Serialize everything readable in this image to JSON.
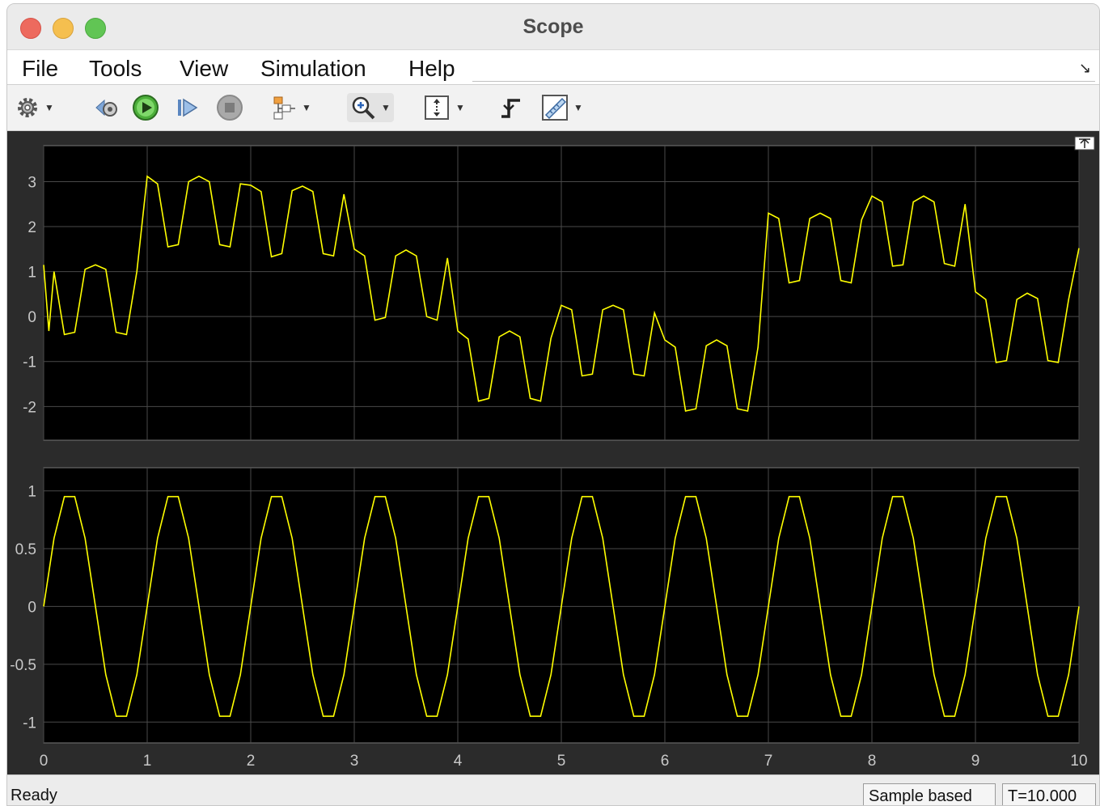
{
  "window": {
    "title": "Scope"
  },
  "menu": {
    "items": [
      "File",
      "Tools",
      "View",
      "Simulation",
      "Help"
    ]
  },
  "toolbar": {
    "icons": [
      "gear-icon",
      "step-back-icon",
      "run-icon",
      "step-forward-icon",
      "stop-icon",
      "highlight-block-icon",
      "zoom-in-icon",
      "scale-axes-icon",
      "triggers-icon",
      "measurements-icon"
    ]
  },
  "status": {
    "text": "Ready",
    "sample_mode": "Sample based",
    "time": "T=10.000"
  },
  "colors": {
    "trace": "#ffff00",
    "axes_bg": "#000000",
    "grid": "#4a4a4a",
    "tick_text": "#c8c8c8",
    "frame_bg": "#2b2b2b"
  },
  "chart_data": [
    {
      "type": "line",
      "xlim": [
        0,
        10
      ],
      "ylim": [
        -2.75,
        3.8
      ],
      "yticks": [
        3,
        2,
        1,
        0,
        -1,
        -2
      ],
      "yticklabels": [
        "3",
        "2",
        "1",
        "0",
        "-1",
        "-2"
      ],
      "xticks": [
        0,
        1,
        2,
        3,
        4,
        5,
        6,
        7,
        8,
        9,
        10
      ],
      "grid": true,
      "series": [
        {
          "x": [
            0,
            0.05,
            0.1,
            0.2,
            0.3,
            0.4,
            0.5,
            0.6,
            0.7,
            0.8,
            0.9,
            1,
            1.1,
            1.2,
            1.3,
            1.4,
            1.5,
            1.6,
            1.7,
            1.8,
            1.9,
            2,
            2.1,
            2.2,
            2.3,
            2.4,
            2.5,
            2.6,
            2.7,
            2.8,
            2.9,
            3,
            3.1,
            3.2,
            3.3,
            3.4,
            3.5,
            3.6,
            3.7,
            3.8,
            3.9,
            4,
            4.1,
            4.2,
            4.3,
            4.4,
            4.5,
            4.6,
            4.7,
            4.8,
            4.9,
            5,
            5.1,
            5.2,
            5.3,
            5.4,
            5.5,
            5.6,
            5.7,
            5.8,
            5.9,
            6,
            6.1,
            6.2,
            6.3,
            6.4,
            6.5,
            6.6,
            6.7,
            6.8,
            6.9,
            7,
            7.1,
            7.2,
            7.3,
            7.4,
            7.5,
            7.6,
            7.7,
            7.8,
            7.9,
            8,
            8.1,
            8.2,
            8.3,
            8.4,
            8.5,
            8.6,
            8.7,
            8.8,
            8.9,
            9,
            9.1,
            9.2,
            9.3,
            9.4,
            9.5,
            9.6,
            9.7,
            9.8,
            9.9,
            10
          ],
          "y": [
            1.15,
            -0.32,
            1.0,
            -0.4,
            -0.35,
            1.05,
            1.15,
            1.05,
            -0.35,
            -0.4,
            1.0,
            3.12,
            2.95,
            1.55,
            1.6,
            3.0,
            3.12,
            3.0,
            1.6,
            1.55,
            2.95,
            2.92,
            2.78,
            1.33,
            1.4,
            2.8,
            2.9,
            2.78,
            1.4,
            1.35,
            2.72,
            1.5,
            1.35,
            -0.08,
            -0.02,
            1.35,
            1.48,
            1.35,
            0.0,
            -0.08,
            1.3,
            -0.32,
            -0.5,
            -1.88,
            -1.82,
            -0.45,
            -0.32,
            -0.45,
            -1.82,
            -1.88,
            -0.48,
            0.25,
            0.15,
            -1.32,
            -1.28,
            0.15,
            0.25,
            0.15,
            -1.28,
            -1.32,
            0.08,
            -0.52,
            -0.68,
            -2.1,
            -2.05,
            -0.65,
            -0.52,
            -0.65,
            -2.05,
            -2.1,
            -0.68,
            2.3,
            2.18,
            0.75,
            0.8,
            2.18,
            2.3,
            2.18,
            0.8,
            0.75,
            2.15,
            2.68,
            2.55,
            1.12,
            1.15,
            2.55,
            2.68,
            2.55,
            1.18,
            1.12,
            2.5,
            0.55,
            0.38,
            -1.02,
            -0.98,
            0.38,
            0.52,
            0.4,
            -0.98,
            -1.02,
            0.38,
            1.52
          ]
        }
      ]
    },
    {
      "type": "line",
      "xlim": [
        0,
        10
      ],
      "ylim": [
        -1.18,
        1.2
      ],
      "yticks": [
        1,
        0.5,
        0,
        -0.5,
        -1
      ],
      "yticklabels": [
        "1",
        "0.5",
        "0",
        "-0.5",
        "-1"
      ],
      "xticks": [
        0,
        1,
        2,
        3,
        4,
        5,
        6,
        7,
        8,
        9,
        10
      ],
      "xticklabels": [
        "0",
        "1",
        "2",
        "3",
        "4",
        "5",
        "6",
        "7",
        "8",
        "9",
        "10"
      ],
      "grid": true,
      "series": [
        {
          "x": [
            0,
            0.1,
            0.2,
            0.3,
            0.4,
            0.5,
            0.6,
            0.7,
            0.8,
            0.9,
            1,
            1.1,
            1.2,
            1.3,
            1.4,
            1.5,
            1.6,
            1.7,
            1.8,
            1.9,
            2,
            2.1,
            2.2,
            2.3,
            2.4,
            2.5,
            2.6,
            2.7,
            2.8,
            2.9,
            3,
            3.1,
            3.2,
            3.3,
            3.4,
            3.5,
            3.6,
            3.7,
            3.8,
            3.9,
            4,
            4.1,
            4.2,
            4.3,
            4.4,
            4.5,
            4.6,
            4.7,
            4.8,
            4.9,
            5,
            5.1,
            5.2,
            5.3,
            5.4,
            5.5,
            5.6,
            5.7,
            5.8,
            5.9,
            6,
            6.1,
            6.2,
            6.3,
            6.4,
            6.5,
            6.6,
            6.7,
            6.8,
            6.9,
            7,
            7.1,
            7.2,
            7.3,
            7.4,
            7.5,
            7.6,
            7.7,
            7.8,
            7.9,
            8,
            8.1,
            8.2,
            8.3,
            8.4,
            8.5,
            8.6,
            8.7,
            8.8,
            8.9,
            9,
            9.1,
            9.2,
            9.3,
            9.4,
            9.5,
            9.6,
            9.7,
            9.8,
            9.9,
            10
          ],
          "y": [
            0,
            0.59,
            0.95,
            0.95,
            0.59,
            0,
            -0.59,
            -0.95,
            -0.95,
            -0.59,
            0,
            0.59,
            0.95,
            0.95,
            0.59,
            0,
            -0.59,
            -0.95,
            -0.95,
            -0.59,
            0,
            0.59,
            0.95,
            0.95,
            0.59,
            0,
            -0.59,
            -0.95,
            -0.95,
            -0.59,
            0,
            0.59,
            0.95,
            0.95,
            0.59,
            0,
            -0.59,
            -0.95,
            -0.95,
            -0.59,
            0,
            0.59,
            0.95,
            0.95,
            0.59,
            0,
            -0.59,
            -0.95,
            -0.95,
            -0.59,
            0,
            0.59,
            0.95,
            0.95,
            0.59,
            0,
            -0.59,
            -0.95,
            -0.95,
            -0.59,
            0,
            0.59,
            0.95,
            0.95,
            0.59,
            0,
            -0.59,
            -0.95,
            -0.95,
            -0.59,
            0,
            0.59,
            0.95,
            0.95,
            0.59,
            0,
            -0.59,
            -0.95,
            -0.95,
            -0.59,
            0,
            0.59,
            0.95,
            0.95,
            0.59,
            0,
            -0.59,
            -0.95,
            -0.95,
            -0.59,
            0,
            0.59,
            0.95,
            0.95,
            0.59,
            0,
            -0.59,
            -0.95,
            -0.95,
            -0.59,
            0
          ]
        }
      ]
    }
  ]
}
